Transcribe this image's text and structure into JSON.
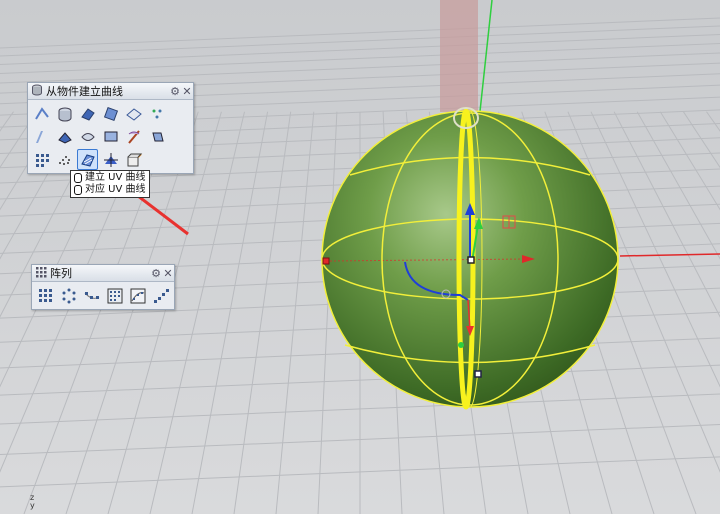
{
  "panels": {
    "curve_from_object": {
      "title": "从物件建立曲线",
      "icons": [
        "duplicate-edge-icon",
        "duplicate-border-icon",
        "duplicate-face-border-icon",
        "extract-isocurve-icon",
        "extract-wireframe-icon",
        "extract-points-icon",
        "project-curve-icon",
        "pull-curve-icon",
        "intersect-icon",
        "contour-icon",
        "section-icon",
        "silhouette-icon",
        "point-cloud-icon",
        "point-set-icon",
        "create-uv-curves-icon",
        "split-surface-icon",
        "camera-box-icon"
      ]
    },
    "array": {
      "title": "阵列",
      "icons": [
        "rectangular-array-icon",
        "polar-array-icon",
        "array-along-curve-icon",
        "array-on-surface-icon",
        "array-along-curve-on-surface-icon",
        "array-linear-icon"
      ]
    }
  },
  "tooltip": {
    "line1": "建立 UV 曲线",
    "line2": "对应 UV 曲线"
  },
  "viewport": {
    "axis_label": "z\ny",
    "colors": {
      "background": "#d4d6d8",
      "grid": "#c3c5c8",
      "sphere": "#5f8f3c",
      "isocurve": "#f2ef3a",
      "x_axis": "#e0282a",
      "y_axis": "#2fcf3f",
      "arrow": "#e8322f"
    }
  }
}
